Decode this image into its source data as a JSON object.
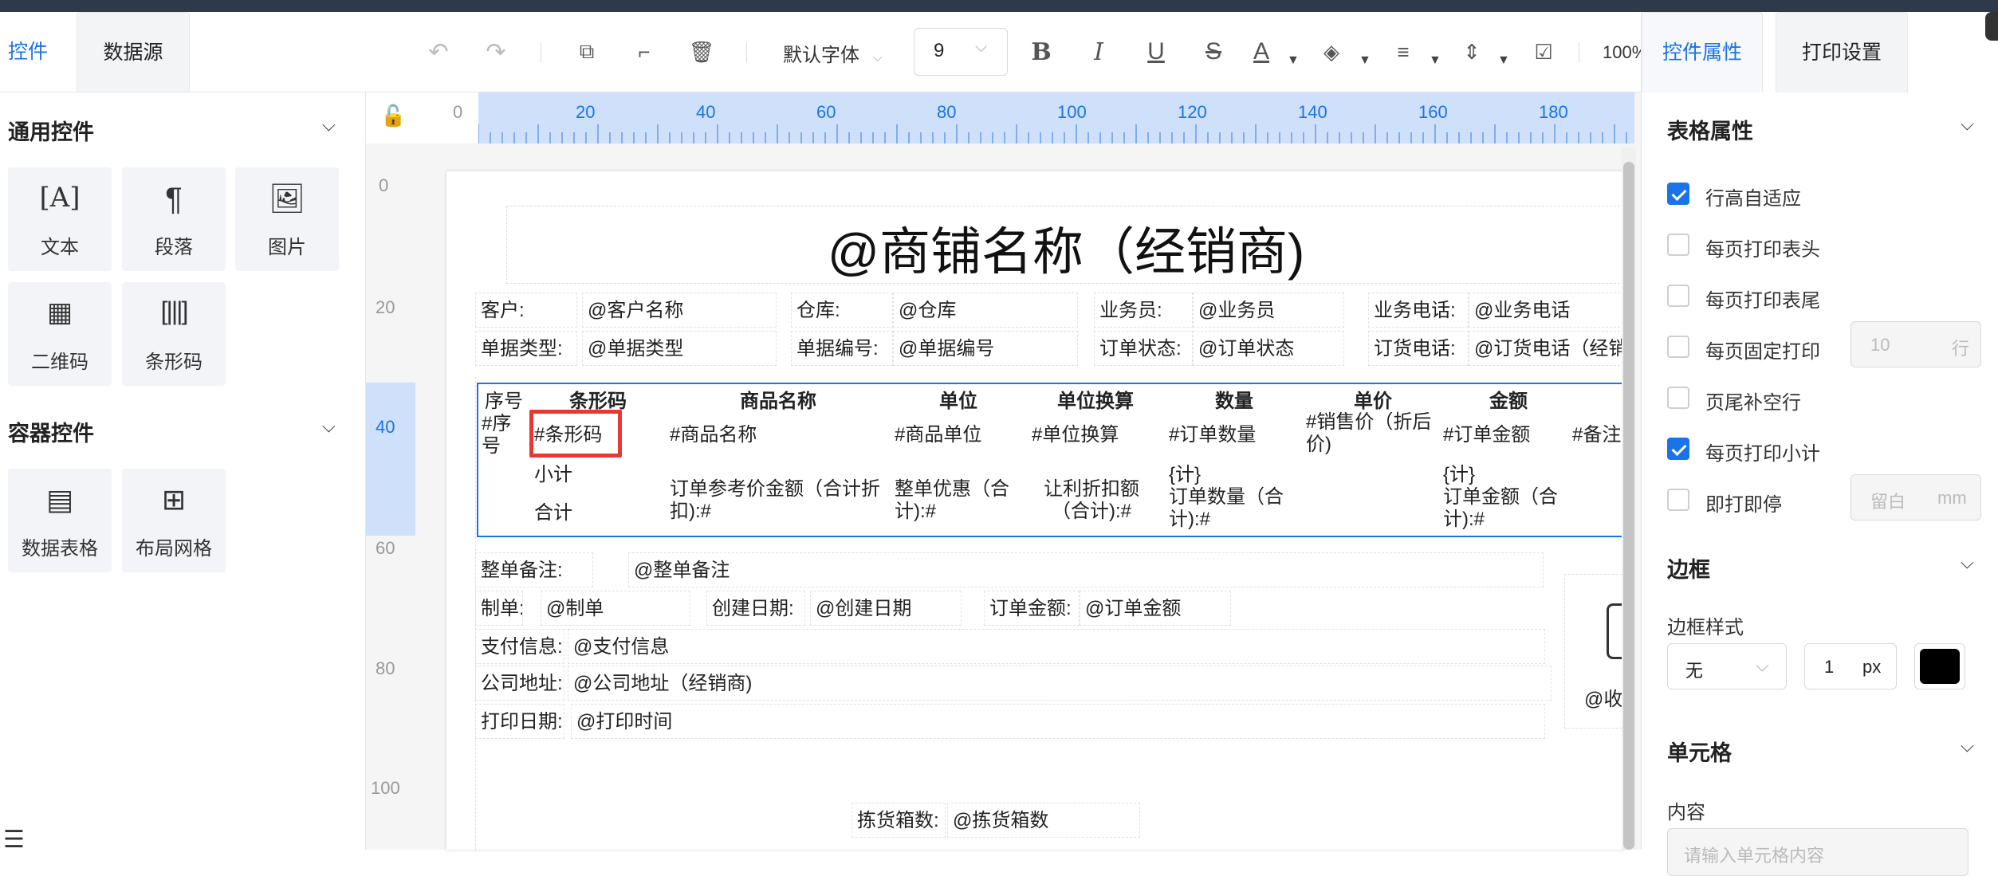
{
  "left_tabs": [
    "控件",
    "数据源"
  ],
  "toolbar": {
    "font": "默认字体",
    "font_size": "9",
    "zoom": "100%"
  },
  "right_tabs": [
    "控件属性",
    "打印设置"
  ],
  "left_panel": {
    "general_title": "通用控件",
    "general_items": [
      {
        "label": "文本",
        "icon": "text-icon"
      },
      {
        "label": "段落",
        "icon": "paragraph-icon"
      },
      {
        "label": "图片",
        "icon": "image-icon"
      },
      {
        "label": "二维码",
        "icon": "qrcode-icon"
      },
      {
        "label": "条形码",
        "icon": "barcode-icon"
      }
    ],
    "container_title": "容器控件",
    "container_items": [
      {
        "label": "数据表格",
        "icon": "table-icon"
      },
      {
        "label": "布局网格",
        "icon": "grid-icon"
      }
    ]
  },
  "ruler": {
    "top": [
      "0",
      "20",
      "40",
      "60",
      "80",
      "100",
      "120",
      "140",
      "160",
      "180"
    ],
    "left": [
      "0",
      "20",
      "40",
      "60",
      "80",
      "100"
    ]
  },
  "paper": {
    "title": "@商铺名称（经销商)",
    "row1": [
      "客户:",
      "@客户名称",
      "仓库:",
      "@仓库",
      "业务员:",
      "@业务员",
      "业务电话:",
      "@业务电话"
    ],
    "row2": [
      "单据类型:",
      "@单据类型",
      "单据编号:",
      "@单据编号",
      "订单状态:",
      "@订单状态",
      "订货电话:",
      "@订货电话（经销"
    ],
    "grid": {
      "headers": [
        "序号",
        "条形码",
        "商品名称",
        "单位",
        "单位换算",
        "数量",
        "单价",
        "金额"
      ],
      "data_row": [
        "#序号",
        "#条形码",
        "#商品名称",
        "#商品单位",
        "#单位换算",
        "#订单数量",
        "#销售价（折后价)",
        "#订单金额",
        "#备注"
      ],
      "subtotal_label": "小计",
      "total_label": "合计",
      "qty_sub": "{计}",
      "amt_sub": "{计}",
      "total_ref": "订单参考价金额（合计折扣):#",
      "total_disc": "整单优惠（合计):#",
      "total_rebate": "让利折扣额（合计):#",
      "total_qty": "订单数量（合计):#",
      "total_amt": "订单金额（合计):#"
    },
    "footer": {
      "remark_label": "整单备注:",
      "remark_value": "@整单备注",
      "maker_label": "制单:",
      "maker_value": "@制单",
      "created_label": "创建日期:",
      "created_value": "@创建日期",
      "amount_label": "订单金额:",
      "amount_value": "@订单金额",
      "pay_label": "支付信息:",
      "pay_value": "@支付信息",
      "addr_label": "公司地址:",
      "addr_value": "@公司地址（经销商)",
      "print_label": "打印日期:",
      "print_value": "@打印时间",
      "receipt_partial": "@收",
      "box_label": "拣货箱数:",
      "box_value": "@拣货箱数"
    }
  },
  "right_panel": {
    "table_props_title": "表格属性",
    "checks": [
      {
        "label": "行高自适应",
        "checked": true
      },
      {
        "label": "每页打印表头",
        "checked": false
      },
      {
        "label": "每页打印表尾",
        "checked": false
      },
      {
        "label": "每页固定打印",
        "checked": false
      },
      {
        "label": "页尾补空行",
        "checked": false
      },
      {
        "label": "每页打印小计",
        "checked": true
      },
      {
        "label": "即打即停",
        "checked": false
      }
    ],
    "fixed_rows_value": "10",
    "fixed_rows_unit": "行",
    "margin_placeholder": "留白",
    "margin_unit": "mm",
    "border_title": "边框",
    "border_style_label": "边框样式",
    "border_style_value": "无",
    "border_width": "1",
    "border_unit": "px",
    "border_color": "#000000",
    "cell_title": "单元格",
    "content_label": "内容",
    "content_placeholder": "请输入单元格内容"
  },
  "accent": "#1a73e8"
}
